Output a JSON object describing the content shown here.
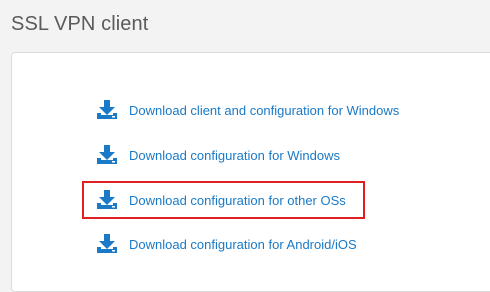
{
  "page": {
    "title": "SSL VPN client"
  },
  "downloads": [
    {
      "label": "Download client and configuration for Windows",
      "icon": "download-icon"
    },
    {
      "label": "Download configuration for Windows",
      "icon": "download-icon"
    },
    {
      "label": "Download configuration for other OSs",
      "icon": "download-icon",
      "highlighted": true
    },
    {
      "label": "Download configuration for Android/iOS",
      "icon": "download-icon"
    }
  ],
  "colors": {
    "link": "#1a7ac7",
    "icon": "#1a7ac7",
    "highlight_border": "#e02020",
    "background": "#f3f3f3",
    "panel": "#ffffff",
    "title": "#5a5a5a"
  }
}
